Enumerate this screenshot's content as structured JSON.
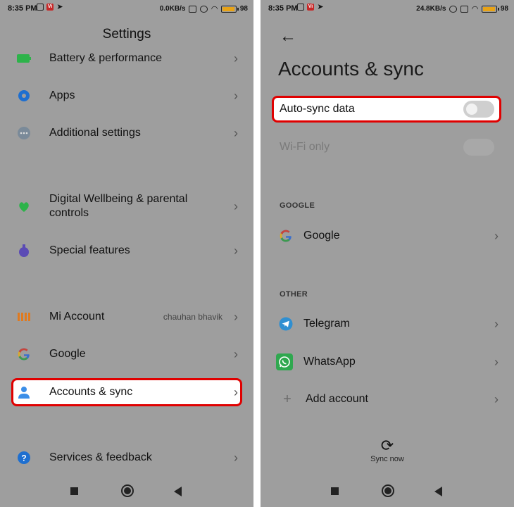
{
  "status_left": {
    "time": "8:35 PM",
    "speed": "0.0KB/s",
    "battery": "98"
  },
  "status_right": {
    "time": "8:35 PM",
    "speed": "24.8KB/s",
    "battery": "98"
  },
  "settings": {
    "title": "Settings",
    "items": [
      {
        "label": "Battery & performance",
        "icon": "battery-icon",
        "color": "#2db34a"
      },
      {
        "label": "Apps",
        "icon": "gear-icon",
        "color": "#1e6fd0"
      },
      {
        "label": "Additional settings",
        "icon": "dots-icon",
        "color": "#7a8a99"
      },
      {
        "label": "Digital Wellbeing & parental controls",
        "icon": "wellbeing-icon",
        "color": "#2db34a"
      },
      {
        "label": "Special features",
        "icon": "special-features-icon",
        "color": "#5b4bb5"
      },
      {
        "label": "Mi Account",
        "sub": "chauhan bhavik",
        "icon": "mi-icon",
        "color": "#e07a1f"
      },
      {
        "label": "Google",
        "icon": "google-icon"
      },
      {
        "label": "Accounts & sync",
        "icon": "person-icon",
        "color": "#3b8ee8"
      },
      {
        "label": "Services & feedback",
        "icon": "help-icon",
        "color": "#1e6fd0"
      }
    ]
  },
  "accounts": {
    "title": "Accounts & sync",
    "auto_sync_label": "Auto-sync data",
    "wifi_only_label": "Wi-Fi only",
    "google_section": "GOOGLE",
    "google_label": "Google",
    "other_section": "OTHER",
    "telegram_label": "Telegram",
    "whatsapp_label": "WhatsApp",
    "add_account_label": "Add account",
    "sync_now_label": "Sync now"
  }
}
